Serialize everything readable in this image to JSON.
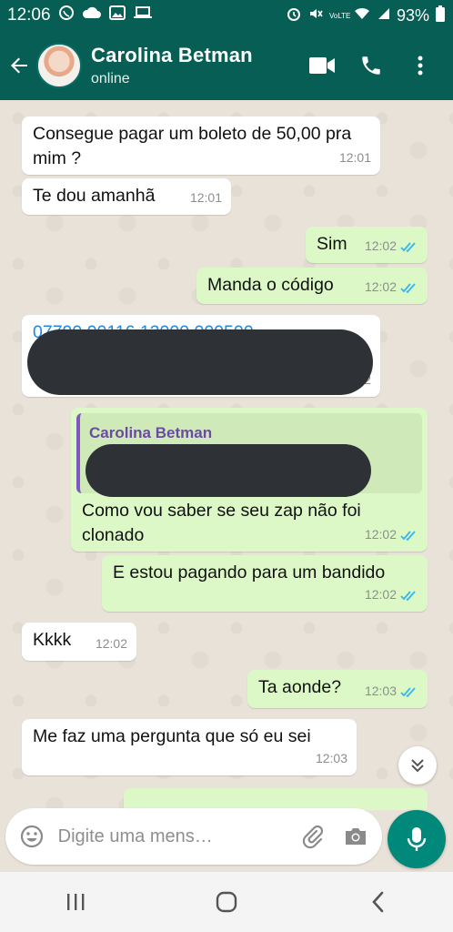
{
  "status_bar": {
    "time": "12:06",
    "battery": "93%",
    "left_icons": [
      "whatsapp-icon",
      "cloud-icon",
      "image-icon",
      "laptop-icon"
    ],
    "right_icons": [
      "alarm-icon",
      "mute-icon",
      "volte-icon",
      "wifi-icon",
      "signal-icon"
    ],
    "volte_label": "VoLTE"
  },
  "header": {
    "contact_name": "Carolina Betman",
    "contact_status": "online",
    "icons": [
      "back-arrow-icon",
      "video-call-icon",
      "phone-icon",
      "more-options-icon"
    ]
  },
  "messages": [
    {
      "dir": "in",
      "text": "Consegue pagar um boleto de 50,00 pra mim ?",
      "time": "12:01"
    },
    {
      "dir": "in",
      "text": "Te dou amanhã",
      "time": "12:01"
    },
    {
      "dir": "out",
      "text": "Sim",
      "time": "12:02",
      "read": true
    },
    {
      "dir": "out",
      "text": "Manda o código",
      "time": "12:02",
      "read": true
    },
    {
      "dir": "in",
      "text": "07790.00116 12000.000500",
      "time": "2",
      "redacted": true
    },
    {
      "dir": "out",
      "quote_name": "Carolina Betman",
      "text": "Como vou saber se seu zap não foi clonado",
      "time": "12:02",
      "read": true
    },
    {
      "dir": "out",
      "text": "E estou pagando para um bandido",
      "time": "12:02",
      "read": true
    },
    {
      "dir": "in",
      "text": "Kkkk",
      "time": "12:02"
    },
    {
      "dir": "out",
      "text": "Ta aonde?",
      "time": "12:03",
      "read": true
    },
    {
      "dir": "in",
      "text": "Me faz uma pergunta que só eu sei",
      "time": "12:03"
    }
  ],
  "composer": {
    "placeholder": "Digite uma mens…",
    "icons": [
      "emoji-icon",
      "attach-icon",
      "camera-icon",
      "microphone-icon"
    ]
  },
  "nav": [
    "recents-icon",
    "home-icon",
    "back-icon"
  ],
  "colors": {
    "header": "#075e54",
    "outgoing": "#dcf8c6",
    "incoming": "#ffffff",
    "accent": "#00897b",
    "read_ticks": "#34b7f1"
  }
}
